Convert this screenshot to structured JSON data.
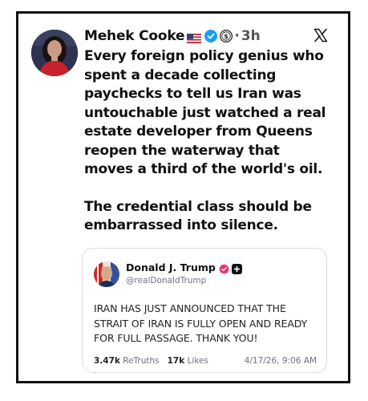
{
  "post": {
    "author_name": "Mehek Cooke",
    "time_separator": "·",
    "time": "3h",
    "paragraphs": [
      "Every foreign policy genius who spent a decade collecting paychecks to tell us Iran was untouchable just watched a real estate developer from Queens reopen the waterway that moves a third of the world's oil.",
      "The credential class should be embarrassed into silence."
    ],
    "icons": {
      "flag": "us-flag-icon",
      "verified": "verified-badge-icon",
      "subscription": "subscription-coin-icon",
      "platform": "x-logo-icon"
    }
  },
  "quoted_post": {
    "author_name": "Donald J. Trump",
    "handle": "@realDonaldTrump",
    "text": "IRAN HAS JUST ANNOUNCED THAT THE STRAIT OF IRAN IS FULLY OPEN AND READY FOR FULL PASSAGE. THANK YOU!",
    "retruths_count": "3.47k",
    "retruths_label": "ReTruths",
    "likes_count": "17k",
    "likes_label": "Likes",
    "date": "4/17/26, 9:06 AM",
    "icons": {
      "verified": "verified-badge-icon",
      "platform": "truth-social-icon"
    }
  },
  "colors": {
    "verified_blue": "#1d9bf0",
    "truth_badge": "#e8336b",
    "text": "#111111",
    "muted": "#6b7280",
    "frame": "#111111"
  }
}
